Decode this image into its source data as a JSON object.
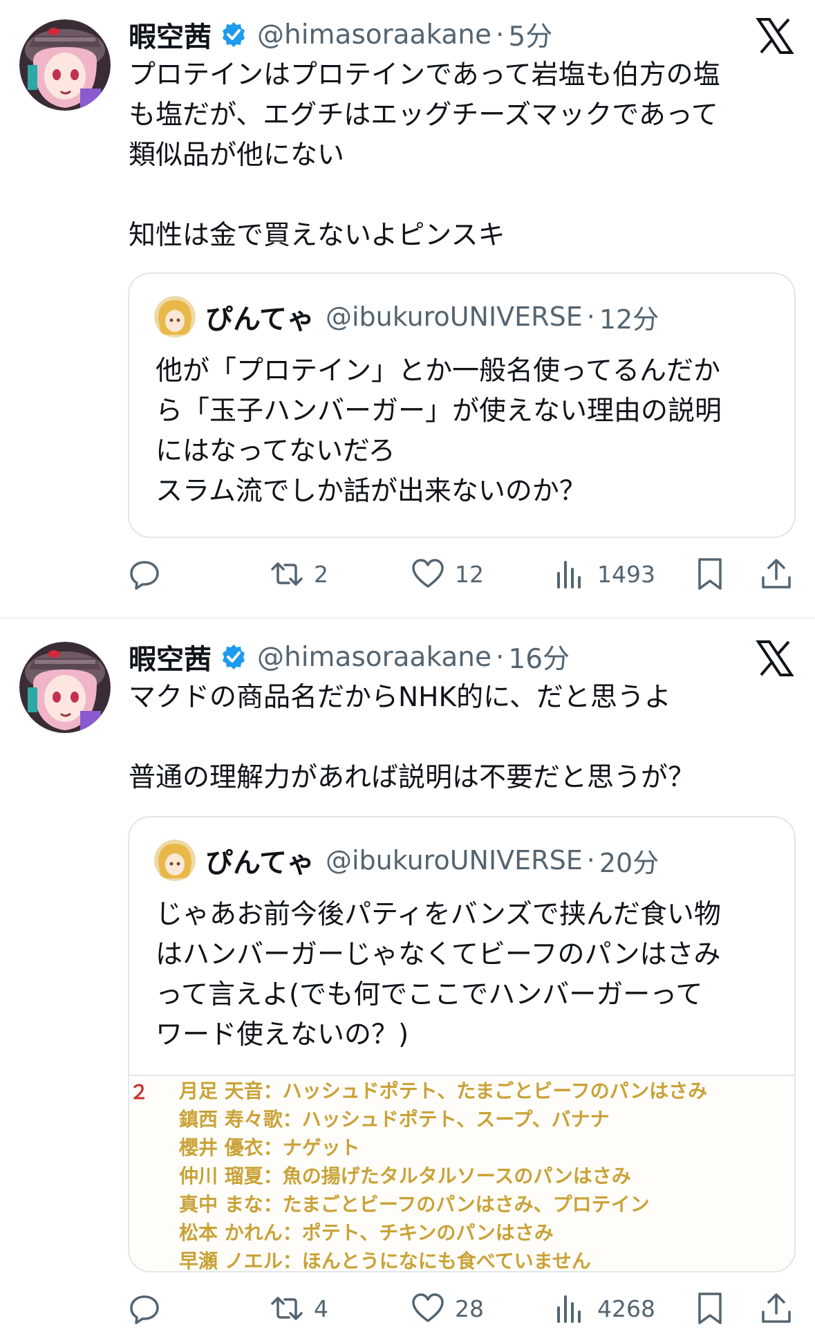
{
  "tweets": [
    {
      "author": {
        "name": "暇空茜",
        "handle": "@himasoraakane",
        "time": "5分"
      },
      "text": "プロテインはプロテインであって岩塩も伯方の塩\nも塩だが、エグチはエッグチーズマックであって\n類似品が他にない\n\n知性は金で買えないよピンスキ",
      "quote": {
        "name": "ぴんてゃ",
        "handle": "@ibukuroUNIVERSE",
        "time": "12分",
        "text": "他が「プロテイン」とか一般名使ってるんだか\nら「玉子ハンバーガー」が使えない理由の説明\nにはなってないだろ\nスラム流でしか話が出来ないのか？"
      },
      "stats": {
        "replies": "",
        "retweets": "2",
        "likes": "12",
        "views": "1493"
      }
    },
    {
      "author": {
        "name": "暇空茜",
        "handle": "@himasoraakane",
        "time": "16分"
      },
      "text": "マクドの商品名だからNHK的に、だと思うよ\n\n普通の理解力があれば説明は不要だと思うが？",
      "quote": {
        "name": "ぴんてゃ",
        "handle": "@ibukuroUNIVERSE",
        "time": "20分",
        "text": "じゃあお前今後パティをバンズで挟んだ食い物\nはハンバーガーじゃなくてビーフのパンはさみ\nって言えよ(でも何でここでハンバーガーって\nワード使えないの？)",
        "image_lines": [
          "月足 天音：ハッシュドポテト、たまごとビーフのパンはさみ",
          "鎮西 寿々歌：ハッシュドポテト、スープ、バナナ",
          "櫻井 優衣：ナゲット",
          "仲川 瑠夏：魚の揚げたタルタルソースのパンはさみ",
          "真中 まな：たまごとビーフのパンはさみ、プロテイン",
          "松本 かれん：ポテト、チキンのパンはさみ",
          "早瀬 ノエル：ほんとうになにも食べていません"
        ],
        "image_edge_mark": "２"
      },
      "stats": {
        "replies": "",
        "retweets": "4",
        "likes": "28",
        "views": "4268"
      }
    }
  ],
  "colors": {
    "accent_blue": "#1d9bf0",
    "muted": "#536471",
    "text": "#0f1419",
    "border": "#e1e6ea",
    "image_text": "#c9a237"
  },
  "icons": [
    "verified-badge-icon",
    "x-logo-icon",
    "reply-icon",
    "retweet-icon",
    "like-icon",
    "views-icon",
    "bookmark-icon",
    "share-icon"
  ]
}
